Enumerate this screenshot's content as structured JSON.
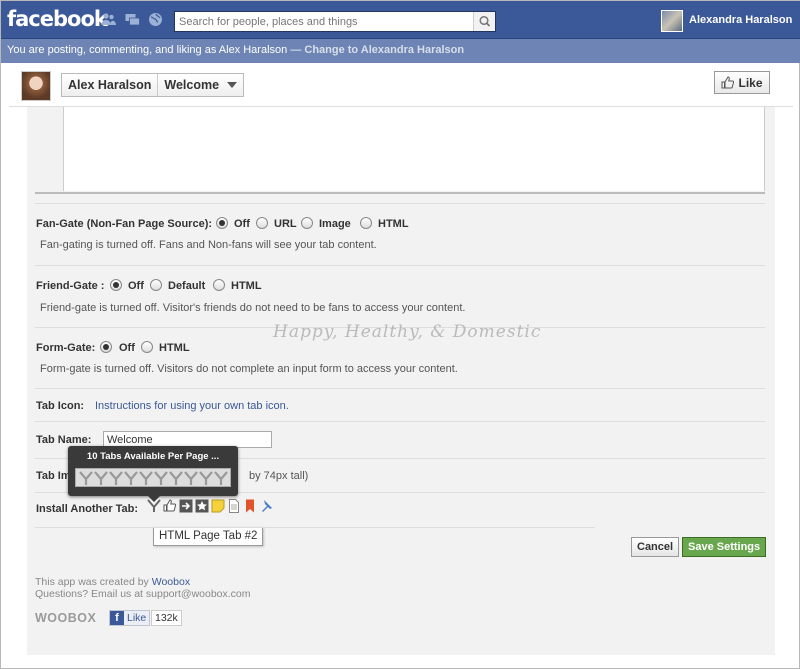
{
  "topbar": {
    "logo": "facebook",
    "search_placeholder": "Search for people, places and things",
    "user_name": "Alexandra Haralson"
  },
  "posting_as": {
    "text": "You are posting, commenting, and liking as Alex Haralson — ",
    "change_link": "Change to Alexandra Haralson"
  },
  "page_header": {
    "page_name": "Alex Haralson",
    "tab_name": "Welcome",
    "like_label": "Like"
  },
  "settings": {
    "fan_gate": {
      "label": "Fan-Gate (Non-Fan Page Source):",
      "options": [
        "Off",
        "URL",
        "Image",
        "HTML"
      ],
      "selected": "Off",
      "description": "Fan-gating is turned off. Fans and Non-fans will see your tab content."
    },
    "friend_gate": {
      "label": "Friend-Gate :",
      "options": [
        "Off",
        "Default",
        "HTML"
      ],
      "selected": "Off",
      "description": "Friend-gate is turned off. Visitor's friends do not need to be fans to access your content."
    },
    "form_gate": {
      "label": "Form-Gate:",
      "options": [
        "Off",
        "HTML"
      ],
      "selected": "Off",
      "description": "Form-gate is turned off. Visitors do not complete an input form to access your content."
    },
    "tab_icon": {
      "label": "Tab Icon:",
      "link": "Instructions for using your own tab icon."
    },
    "tab_name": {
      "label": "Tab Name:",
      "value": "Welcome"
    },
    "tab_image": {
      "label_visible": "Tab Im",
      "hint_visible": "by 74px tall)"
    },
    "install_another": {
      "label": "Install Another Tab:",
      "tooltip_title": "10 Tabs Available Per Page ...",
      "hover_tip": "HTML Page Tab #2"
    },
    "cancel_label": "Cancel",
    "save_label": "Save Settings"
  },
  "footer": {
    "created_by_prefix": "This app was created by ",
    "created_by_link": "Woobox",
    "questions": "Questions? Email us at support@woobox.com",
    "woobox_logo": "WOOBOX",
    "fb_like_label": "Like",
    "fb_like_count": "132k"
  },
  "watermark": "Happy, Healthy, & Domestic",
  "colors": {
    "facebook_blue": "#3b5998",
    "posting_bar": "#6d84b4",
    "save_green": "#69a74e",
    "link": "#3b5998"
  }
}
